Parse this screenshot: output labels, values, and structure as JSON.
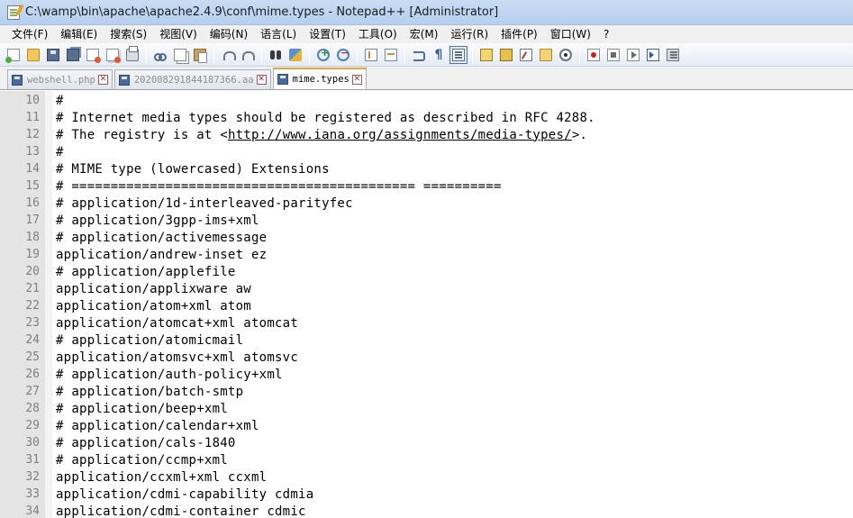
{
  "window": {
    "title": "C:\\wamp\\bin\\apache\\apache2.4.9\\conf\\mime.types - Notepad++ [Administrator]"
  },
  "menu": [
    "文件(F)",
    "编辑(E)",
    "搜索(S)",
    "视图(V)",
    "编码(N)",
    "语言(L)",
    "设置(T)",
    "工具(O)",
    "宏(M)",
    "运行(R)",
    "插件(P)",
    "窗口(W)",
    "?"
  ],
  "toolbar": {
    "icons": [
      "new-file-icon",
      "open-file-icon",
      "save-icon",
      "save-all-icon",
      "close-icon",
      "close-all-icon",
      "print-icon",
      "cut-icon",
      "copy-icon",
      "paste-icon",
      "undo-icon",
      "redo-icon",
      "find-icon",
      "replace-icon",
      "zoom-in-icon",
      "zoom-out-icon",
      "sync-vertical-icon",
      "sync-horizontal-icon",
      "word-wrap-icon",
      "show-all-chars-icon",
      "indent-guide-icon",
      "user-defined-language-icon",
      "document-map-icon",
      "function-list-icon",
      "folder-as-workspace-icon",
      "monitoring-icon",
      "record-macro-icon",
      "stop-record-icon",
      "playback-icon",
      "run-macro-multiple-icon",
      "save-macro-icon"
    ]
  },
  "tabs": [
    {
      "label": "webshell.php",
      "active": false
    },
    {
      "label": "2020082918441873​66.aa",
      "active": false
    },
    {
      "label": "mime.types",
      "active": true
    }
  ],
  "editor": {
    "lines": [
      {
        "num": "10",
        "text": "#"
      },
      {
        "num": "11",
        "text": "# Internet media types should be registered as described in RFC 4288."
      },
      {
        "num": "12",
        "pre": "# The registry is at <",
        "link": "http://www.iana.org/assignments/media-types/",
        "post": ">."
      },
      {
        "num": "13",
        "text": "#"
      },
      {
        "num": "14",
        "text": "# MIME type (lowercased)            Extensions"
      },
      {
        "num": "15",
        "text": "# ============================================  =========="
      },
      {
        "num": "16",
        "text": "# application/1d-interleaved-parityfec"
      },
      {
        "num": "17",
        "text": "# application/3gpp-ims+xml"
      },
      {
        "num": "18",
        "text": "# application/activemessage"
      },
      {
        "num": "19",
        "text": "application/andrew-inset             ez"
      },
      {
        "num": "20",
        "text": "# application/applefile"
      },
      {
        "num": "21",
        "text": "application/applixware               aw"
      },
      {
        "num": "22",
        "text": "application/atom+xml                 atom"
      },
      {
        "num": "23",
        "text": "application/atomcat+xml              atomcat"
      },
      {
        "num": "24",
        "text": "# application/atomicmail"
      },
      {
        "num": "25",
        "text": "application/atomsvc+xml              atomsvc"
      },
      {
        "num": "26",
        "text": "# application/auth-policy+xml"
      },
      {
        "num": "27",
        "text": "# application/batch-smtp"
      },
      {
        "num": "28",
        "text": "# application/beep+xml"
      },
      {
        "num": "29",
        "text": "# application/calendar+xml"
      },
      {
        "num": "30",
        "text": "# application/cals-1840"
      },
      {
        "num": "31",
        "text": "# application/ccmp+xml"
      },
      {
        "num": "32",
        "text": "application/ccxml+xml                ccxml"
      },
      {
        "num": "33",
        "text": "application/cdmi-capability          cdmia"
      },
      {
        "num": "34",
        "text": "application/cdmi-container           cdmic"
      }
    ]
  }
}
